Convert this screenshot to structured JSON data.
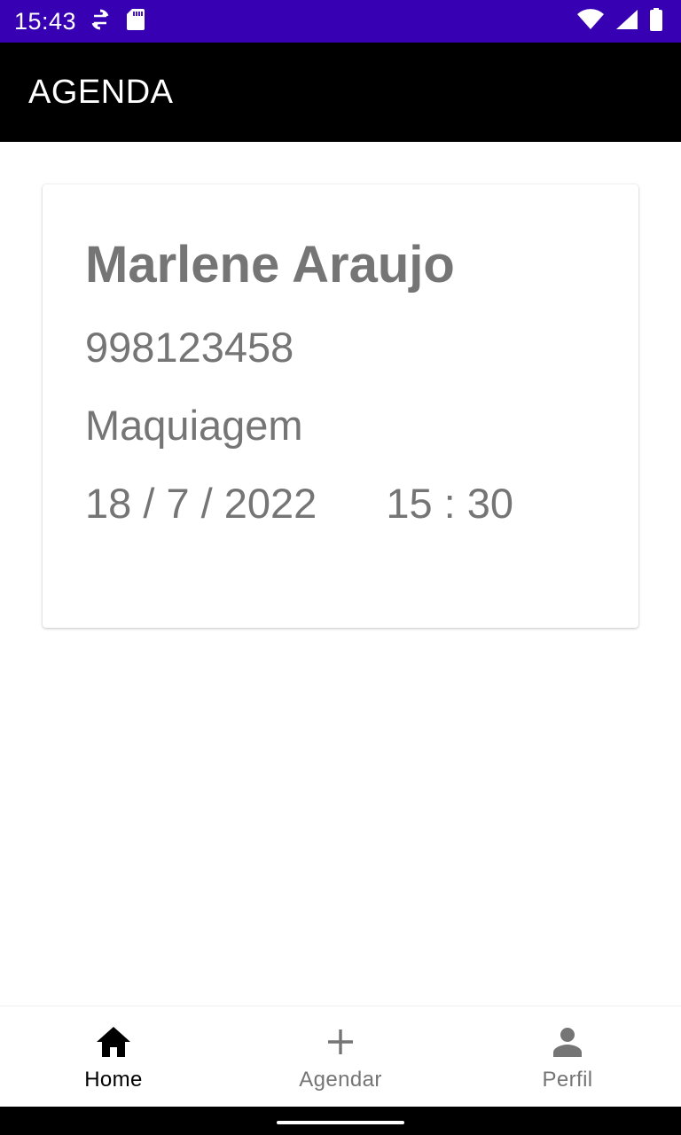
{
  "status_bar": {
    "time": "15:43",
    "left_icons": [
      "sync-icon",
      "sd-card-icon"
    ],
    "right_icons": [
      "wifi-icon",
      "signal-icon",
      "battery-icon"
    ],
    "background": "#3700b3"
  },
  "app_bar": {
    "title": "AGENDA",
    "background": "#000000"
  },
  "appointment_card": {
    "name": "Marlene Araujo",
    "phone": "998123458",
    "service": "Maquiagem",
    "date": "18 / 7 / 2022",
    "time": "15 : 30"
  },
  "bottom_nav": {
    "items": [
      {
        "label": "Home",
        "icon": "home-icon",
        "active": true
      },
      {
        "label": "Agendar",
        "icon": "plus-icon",
        "active": false
      },
      {
        "label": "Perfil",
        "icon": "person-icon",
        "active": false
      }
    ]
  },
  "colors": {
    "card_text": "#757575",
    "nav_active": "#000000",
    "nav_inactive": "#757575"
  }
}
